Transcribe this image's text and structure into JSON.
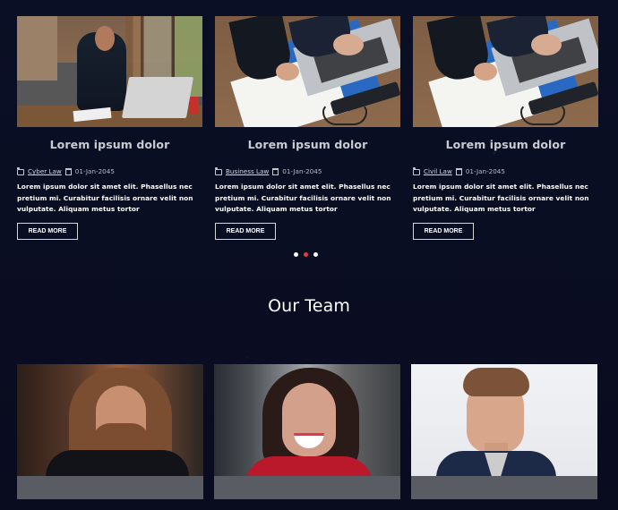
{
  "blog": {
    "cards": [
      {
        "title": "Lorem ipsum dolor",
        "category": "Cyber Law",
        "date": "01-Jan-2045",
        "excerpt": "Lorem ipsum dolor sit amet elit. Phasellus nec pretium mi. Curabitur facilisis ornare velit non vulputate. Aliquam metus tortor",
        "button": "READ MORE"
      },
      {
        "title": "Lorem ipsum dolor",
        "category": "Business Law",
        "date": "01-Jan-2045",
        "excerpt": "Lorem ipsum dolor sit amet elit. Phasellus nec pretium mi. Curabitur facilisis ornare velit non vulputate. Aliquam metus tortor",
        "button": "READ MORE"
      },
      {
        "title": "Lorem ipsum dolor",
        "category": "Civil Law",
        "date": "01-Jan-2045",
        "excerpt": "Lorem ipsum dolor sit amet elit. Phasellus nec pretium mi. Curabitur facilisis ornare velit non vulputate. Aliquam metus tortor",
        "button": "READ MORE"
      }
    ],
    "carousel": {
      "active_index": 1,
      "active_color": "#e63c3c",
      "inactive_color": "#ffffff"
    }
  },
  "team": {
    "title": "Our Team"
  }
}
